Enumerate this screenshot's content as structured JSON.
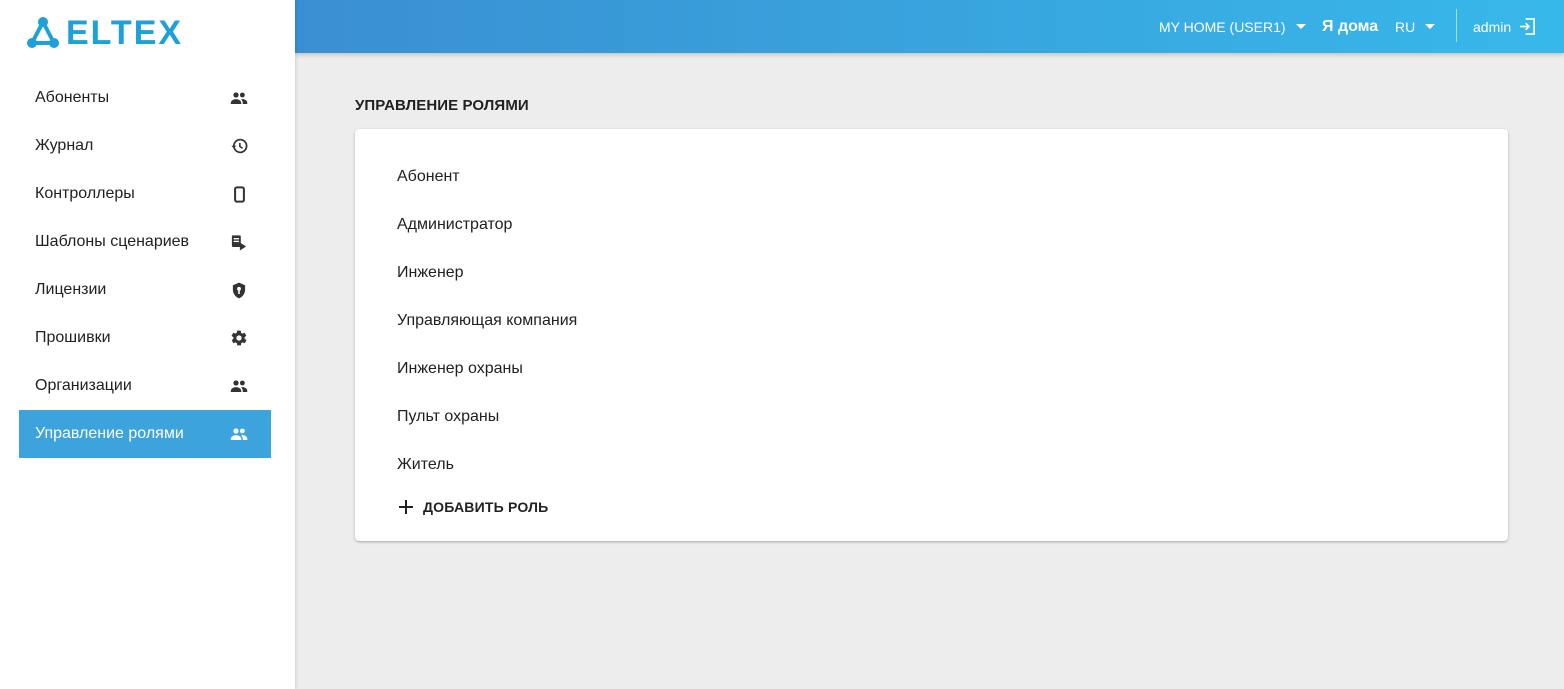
{
  "logo": {
    "text": "ELTEX"
  },
  "sidebar": {
    "items": [
      {
        "label": "Абоненты",
        "icon": "people-icon",
        "active": false
      },
      {
        "label": "Журнал",
        "icon": "history-icon",
        "active": false
      },
      {
        "label": "Контроллеры",
        "icon": "phone-icon",
        "active": false
      },
      {
        "label": "Шаблоны сценариев",
        "icon": "script-icon",
        "active": false
      },
      {
        "label": "Лицензии",
        "icon": "shield-key-icon",
        "active": false
      },
      {
        "label": "Прошивки",
        "icon": "gear-icon",
        "active": false
      },
      {
        "label": "Организации",
        "icon": "people-icon",
        "active": false
      },
      {
        "label": "Управление ролями",
        "icon": "people-icon",
        "active": true
      }
    ]
  },
  "header": {
    "home_select": "MY HOME (USER1)",
    "ya_doma": "Я дома",
    "lang": "RU",
    "user": "admin"
  },
  "main": {
    "title": "УПРАВЛЕНИЕ РОЛЯМИ",
    "roles": [
      "Абонент",
      "Администратор",
      "Инженер",
      "Управляющая компания",
      "Инженер охраны",
      "Пульт охраны",
      "Житель"
    ],
    "add_role_label": "ДОБАВИТЬ РОЛЬ"
  },
  "colors": {
    "accent": "#3da3dc",
    "header_start": "#3a8fd2",
    "header_end": "#37b8ea",
    "background": "#ededed",
    "logo": "#1da1d8"
  }
}
